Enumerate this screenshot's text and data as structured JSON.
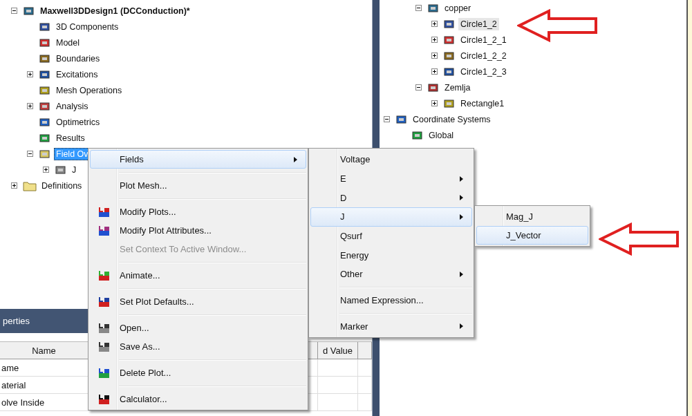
{
  "left_tree": {
    "items": [
      {
        "label": "Maxwell3DDesign1 (DCConduction)*",
        "expanded": true,
        "selected": false,
        "children": [
          {
            "label": "3D Components",
            "selected": false
          },
          {
            "label": "Model",
            "selected": false
          },
          {
            "label": "Boundaries",
            "selected": false
          },
          {
            "label": "Excitations",
            "expanded": false,
            "selected": false
          },
          {
            "label": "Mesh Operations",
            "selected": false
          },
          {
            "label": "Analysis",
            "expanded": false,
            "selected": false
          },
          {
            "label": "Optimetrics",
            "selected": false
          },
          {
            "label": "Results",
            "selected": false
          },
          {
            "label": "Field Ov",
            "expanded": true,
            "selected": true,
            "children": [
              {
                "label": "J",
                "expanded": false,
                "selected": false
              }
            ]
          }
        ]
      },
      {
        "label": "Definitions",
        "expanded": false,
        "selected": false
      }
    ]
  },
  "properties": {
    "title": "perties",
    "columns": [
      "Name",
      "d Value"
    ],
    "rows": [
      "ame",
      "aterial",
      "olve Inside"
    ]
  },
  "right_tree": {
    "continued_children": [
      {
        "label": "copper",
        "expanded": true,
        "selected": false,
        "children": [
          {
            "label": "Circle1_2",
            "expanded": false,
            "selected": true
          },
          {
            "label": "Circle1_2_1",
            "expanded": false,
            "selected": false
          },
          {
            "label": "Circle1_2_2",
            "expanded": false,
            "selected": false
          },
          {
            "label": "Circle1_2_3",
            "expanded": false,
            "selected": false
          }
        ]
      },
      {
        "label": "Zemlja",
        "expanded": true,
        "selected": false,
        "children": [
          {
            "label": "Rectangle1",
            "expanded": false,
            "selected": false
          }
        ]
      }
    ],
    "items": [
      {
        "label": "Coordinate Systems",
        "expanded": true,
        "selected": false,
        "children": [
          {
            "label": "Global",
            "selected": false
          }
        ]
      }
    ]
  },
  "context_menu": {
    "items": [
      {
        "kind": "item",
        "label": "Fields",
        "selected": true,
        "submenu": true,
        "disabled": false,
        "has_icon": false
      },
      {
        "kind": "separator"
      },
      {
        "kind": "item",
        "label": "Plot Mesh...",
        "selected": false,
        "submenu": false,
        "disabled": false,
        "has_icon": false
      },
      {
        "kind": "separator"
      },
      {
        "kind": "item",
        "label": "Modify Plots...",
        "selected": false,
        "submenu": false,
        "disabled": false,
        "has_icon": true
      },
      {
        "kind": "item",
        "label": "Modify Plot Attributes...",
        "selected": false,
        "submenu": false,
        "disabled": false,
        "has_icon": true
      },
      {
        "kind": "item",
        "label": "Set Context To Active Window...",
        "selected": false,
        "submenu": false,
        "disabled": true,
        "has_icon": false
      },
      {
        "kind": "separator"
      },
      {
        "kind": "item",
        "label": "Animate...",
        "selected": false,
        "submenu": false,
        "disabled": false,
        "has_icon": true
      },
      {
        "kind": "separator"
      },
      {
        "kind": "item",
        "label": "Set Plot Defaults...",
        "selected": false,
        "submenu": false,
        "disabled": false,
        "has_icon": true
      },
      {
        "kind": "separator"
      },
      {
        "kind": "item",
        "label": "Open...",
        "selected": false,
        "submenu": false,
        "disabled": false,
        "has_icon": true
      },
      {
        "kind": "item",
        "label": "Save As...",
        "selected": false,
        "submenu": false,
        "disabled": false,
        "has_icon": true
      },
      {
        "kind": "separator"
      },
      {
        "kind": "item",
        "label": "Delete Plot...",
        "selected": false,
        "submenu": false,
        "disabled": false,
        "has_icon": true
      },
      {
        "kind": "separator"
      },
      {
        "kind": "item",
        "label": "Calculator...",
        "selected": false,
        "submenu": false,
        "disabled": false,
        "has_icon": true
      }
    ]
  },
  "fields_submenu": {
    "items": [
      {
        "kind": "item",
        "label": "Voltage",
        "selected": false,
        "submenu": false
      },
      {
        "kind": "item",
        "label": "E",
        "selected": false,
        "submenu": true
      },
      {
        "kind": "item",
        "label": "D",
        "selected": false,
        "submenu": true
      },
      {
        "kind": "item",
        "label": "J",
        "selected": true,
        "submenu": true
      },
      {
        "kind": "item",
        "label": "Qsurf",
        "selected": false,
        "submenu": false
      },
      {
        "kind": "item",
        "label": "Energy",
        "selected": false,
        "submenu": false
      },
      {
        "kind": "item",
        "label": "Other",
        "selected": false,
        "submenu": true
      },
      {
        "kind": "separator"
      },
      {
        "kind": "item",
        "label": "Named Expression...",
        "selected": false,
        "submenu": false
      },
      {
        "kind": "separator"
      },
      {
        "kind": "item",
        "label": "Marker",
        "selected": false,
        "submenu": true
      }
    ]
  },
  "j_submenu": {
    "items": [
      {
        "kind": "item",
        "label": "Mag_J",
        "selected": false,
        "submenu": false
      },
      {
        "kind": "item",
        "label": "J_Vector",
        "selected": true,
        "submenu": false
      }
    ]
  }
}
